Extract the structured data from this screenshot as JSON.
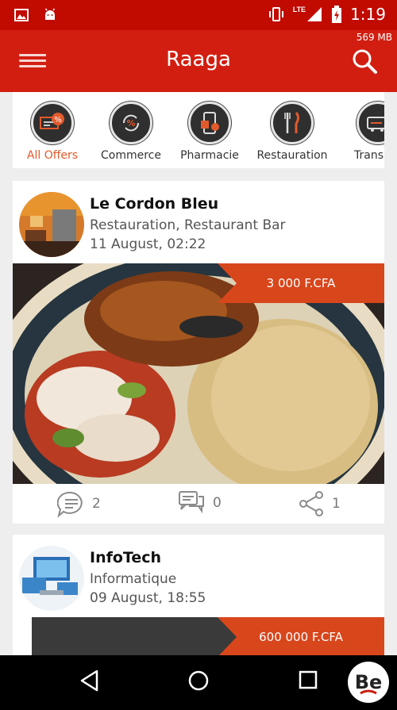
{
  "status_bar": {
    "time": "1:19",
    "network": "LTE",
    "memory": "569 MB"
  },
  "app_bar": {
    "title": "Raaga"
  },
  "categories": [
    {
      "label": "All Offers",
      "icon": "offers-icon",
      "active": true
    },
    {
      "label": "Commerce",
      "icon": "commerce-icon",
      "active": false
    },
    {
      "label": "Pharmacie",
      "icon": "pharmacy-icon",
      "active": false
    },
    {
      "label": "Restauration",
      "icon": "restaurant-icon",
      "active": false
    },
    {
      "label": "Transp",
      "icon": "transport-icon",
      "active": false
    }
  ],
  "offers": [
    {
      "merchant": "Le Cordon Bleu",
      "category": "Restauration, Restaurant Bar",
      "date": "11 August, 02:22",
      "price": "3 000 F.CFA",
      "comments": "2",
      "messages": "0",
      "shares": "1"
    },
    {
      "merchant": "InfoTech",
      "category": "Informatique",
      "date": "09 August, 18:55",
      "price": "600 000 F.CFA"
    }
  ],
  "colors": {
    "primary": "#d21e10",
    "price_tag": "#d8461c",
    "active_category": "#e25a2c"
  }
}
